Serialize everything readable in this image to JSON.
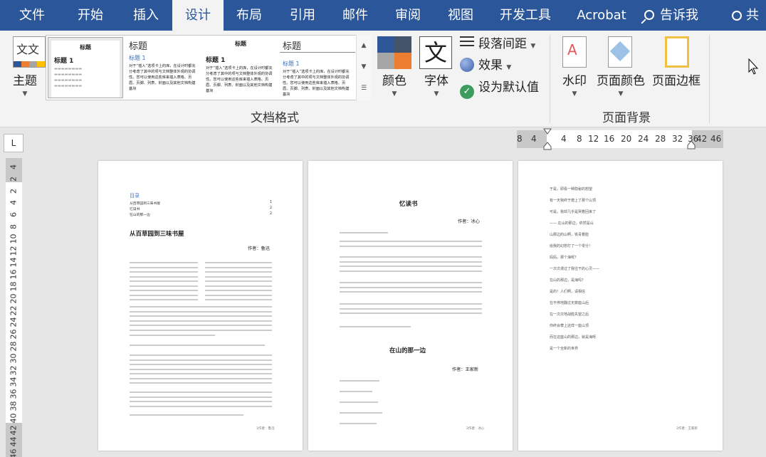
{
  "tabs": [
    "文件",
    "开始",
    "插入",
    "设计",
    "布局",
    "引用",
    "邮件",
    "审阅",
    "视图",
    "开发工具",
    "Acrobat"
  ],
  "active_tab": "设计",
  "tell_me": "告诉我",
  "share_label": "共",
  "ribbon": {
    "theme_label": "主题",
    "theme_icon_text": "文文",
    "gallery": [
      {
        "title": "标题",
        "h1": "标题 1"
      },
      {
        "title": "标题",
        "h1": "标题 1"
      },
      {
        "title": "标题",
        "h1": "标题 1"
      },
      {
        "title": "标题",
        "h1": "标题 1"
      }
    ],
    "gallery_body": "对于“插入”选项卡上的库，在设计时都充分考虑了其中的项与文档整体外观的协调性。您可以使用这些库来插入表格、页眉、页脚、列表、封面以及其他文档构建基块",
    "colors_label": "颜色",
    "fonts_label": "字体",
    "font_icon_text": "文",
    "paragraph_spacing": "段落间距",
    "effects": "效果",
    "set_default": "设为默认值",
    "doc_format_group": "文档格式",
    "watermark": "水印",
    "page_color": "页面颜色",
    "page_borders": "页面边框",
    "page_bg_group": "页面背景",
    "theme_colors": [
      "#2e5597",
      "#ed7d31",
      "#4472c4",
      "#a5a5a5"
    ]
  },
  "ruler": {
    "corner": "L",
    "h_ticks": [
      "8",
      "4",
      "4",
      "8",
      "12",
      "16",
      "20",
      "24",
      "28",
      "32",
      "36",
      "42",
      "46"
    ],
    "v_ticks": [
      "4",
      "2",
      "2",
      "4",
      "6",
      "8",
      "10",
      "12",
      "14",
      "16",
      "18",
      "20",
      "22",
      "24",
      "26",
      "28",
      "30",
      "32",
      "34",
      "36",
      "38",
      "40",
      "42",
      "44",
      "46"
    ]
  },
  "pages": {
    "p1": {
      "toc_title": "目录",
      "toc": [
        {
          "label": "从百草园到三味书屋",
          "page": "1"
        },
        {
          "label": "忆读书",
          "page": "2"
        },
        {
          "label": "在山的那一边",
          "page": "2"
        }
      ],
      "title": "从百草园到三味书屋",
      "author": "作者：鲁迅",
      "footer": "1作者：鲁迅"
    },
    "p2": {
      "title": "忆读书",
      "author": "作者：冰心",
      "title2": "在山的那一边",
      "author2": "作者：王家新",
      "footer": "2作者：冰心"
    },
    "p3": {
      "lines": [
        "于是，即看一种隐秘的想望",
        "有一天我终于爬上了那个山顶",
        "可是，我却几乎是哭着回来了",
        "—— 在山的那边，依然是山",
        "山那边的山啊，铁青着脸",
        "给我的幻想打了一个零分！",
        "妈妈，那个海呢？",
        "一次次漫过了我往干的心灵——",
        "在山的那边，是海吗？",
        "是的！人们啊，请相信",
        "在不停地翻过无数座山后",
        "在一次次地战胜失望之后",
        "你终会攀上这样一座山顶",
        "而在这座山的那边，就是海呀",
        "是一个全新的世界"
      ],
      "footer": "2作者：王家新"
    }
  }
}
